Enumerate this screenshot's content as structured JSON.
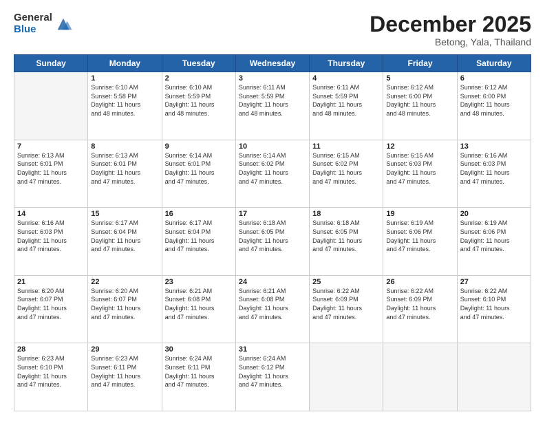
{
  "header": {
    "logo_general": "General",
    "logo_blue": "Blue",
    "month": "December 2025",
    "location": "Betong, Yala, Thailand"
  },
  "weekdays": [
    "Sunday",
    "Monday",
    "Tuesday",
    "Wednesday",
    "Thursday",
    "Friday",
    "Saturday"
  ],
  "weeks": [
    [
      {
        "day": "",
        "empty": true
      },
      {
        "day": "1",
        "sunrise": "6:10 AM",
        "sunset": "5:58 PM",
        "daylight": "11 hours and 48 minutes."
      },
      {
        "day": "2",
        "sunrise": "6:10 AM",
        "sunset": "5:59 PM",
        "daylight": "11 hours and 48 minutes."
      },
      {
        "day": "3",
        "sunrise": "6:11 AM",
        "sunset": "5:59 PM",
        "daylight": "11 hours and 48 minutes."
      },
      {
        "day": "4",
        "sunrise": "6:11 AM",
        "sunset": "5:59 PM",
        "daylight": "11 hours and 48 minutes."
      },
      {
        "day": "5",
        "sunrise": "6:12 AM",
        "sunset": "6:00 PM",
        "daylight": "11 hours and 48 minutes."
      },
      {
        "day": "6",
        "sunrise": "6:12 AM",
        "sunset": "6:00 PM",
        "daylight": "11 hours and 48 minutes."
      }
    ],
    [
      {
        "day": "7",
        "sunrise": "6:13 AM",
        "sunset": "6:01 PM",
        "daylight": "11 hours and 47 minutes."
      },
      {
        "day": "8",
        "sunrise": "6:13 AM",
        "sunset": "6:01 PM",
        "daylight": "11 hours and 47 minutes."
      },
      {
        "day": "9",
        "sunrise": "6:14 AM",
        "sunset": "6:01 PM",
        "daylight": "11 hours and 47 minutes."
      },
      {
        "day": "10",
        "sunrise": "6:14 AM",
        "sunset": "6:02 PM",
        "daylight": "11 hours and 47 minutes."
      },
      {
        "day": "11",
        "sunrise": "6:15 AM",
        "sunset": "6:02 PM",
        "daylight": "11 hours and 47 minutes."
      },
      {
        "day": "12",
        "sunrise": "6:15 AM",
        "sunset": "6:03 PM",
        "daylight": "11 hours and 47 minutes."
      },
      {
        "day": "13",
        "sunrise": "6:16 AM",
        "sunset": "6:03 PM",
        "daylight": "11 hours and 47 minutes."
      }
    ],
    [
      {
        "day": "14",
        "sunrise": "6:16 AM",
        "sunset": "6:03 PM",
        "daylight": "11 hours and 47 minutes."
      },
      {
        "day": "15",
        "sunrise": "6:17 AM",
        "sunset": "6:04 PM",
        "daylight": "11 hours and 47 minutes."
      },
      {
        "day": "16",
        "sunrise": "6:17 AM",
        "sunset": "6:04 PM",
        "daylight": "11 hours and 47 minutes."
      },
      {
        "day": "17",
        "sunrise": "6:18 AM",
        "sunset": "6:05 PM",
        "daylight": "11 hours and 47 minutes."
      },
      {
        "day": "18",
        "sunrise": "6:18 AM",
        "sunset": "6:05 PM",
        "daylight": "11 hours and 47 minutes."
      },
      {
        "day": "19",
        "sunrise": "6:19 AM",
        "sunset": "6:06 PM",
        "daylight": "11 hours and 47 minutes."
      },
      {
        "day": "20",
        "sunrise": "6:19 AM",
        "sunset": "6:06 PM",
        "daylight": "11 hours and 47 minutes."
      }
    ],
    [
      {
        "day": "21",
        "sunrise": "6:20 AM",
        "sunset": "6:07 PM",
        "daylight": "11 hours and 47 minutes."
      },
      {
        "day": "22",
        "sunrise": "6:20 AM",
        "sunset": "6:07 PM",
        "daylight": "11 hours and 47 minutes."
      },
      {
        "day": "23",
        "sunrise": "6:21 AM",
        "sunset": "6:08 PM",
        "daylight": "11 hours and 47 minutes."
      },
      {
        "day": "24",
        "sunrise": "6:21 AM",
        "sunset": "6:08 PM",
        "daylight": "11 hours and 47 minutes."
      },
      {
        "day": "25",
        "sunrise": "6:22 AM",
        "sunset": "6:09 PM",
        "daylight": "11 hours and 47 minutes."
      },
      {
        "day": "26",
        "sunrise": "6:22 AM",
        "sunset": "6:09 PM",
        "daylight": "11 hours and 47 minutes."
      },
      {
        "day": "27",
        "sunrise": "6:22 AM",
        "sunset": "6:10 PM",
        "daylight": "11 hours and 47 minutes."
      }
    ],
    [
      {
        "day": "28",
        "sunrise": "6:23 AM",
        "sunset": "6:10 PM",
        "daylight": "11 hours and 47 minutes."
      },
      {
        "day": "29",
        "sunrise": "6:23 AM",
        "sunset": "6:11 PM",
        "daylight": "11 hours and 47 minutes."
      },
      {
        "day": "30",
        "sunrise": "6:24 AM",
        "sunset": "6:11 PM",
        "daylight": "11 hours and 47 minutes."
      },
      {
        "day": "31",
        "sunrise": "6:24 AM",
        "sunset": "6:12 PM",
        "daylight": "11 hours and 47 minutes."
      },
      {
        "day": "",
        "empty": true
      },
      {
        "day": "",
        "empty": true
      },
      {
        "day": "",
        "empty": true
      }
    ]
  ]
}
